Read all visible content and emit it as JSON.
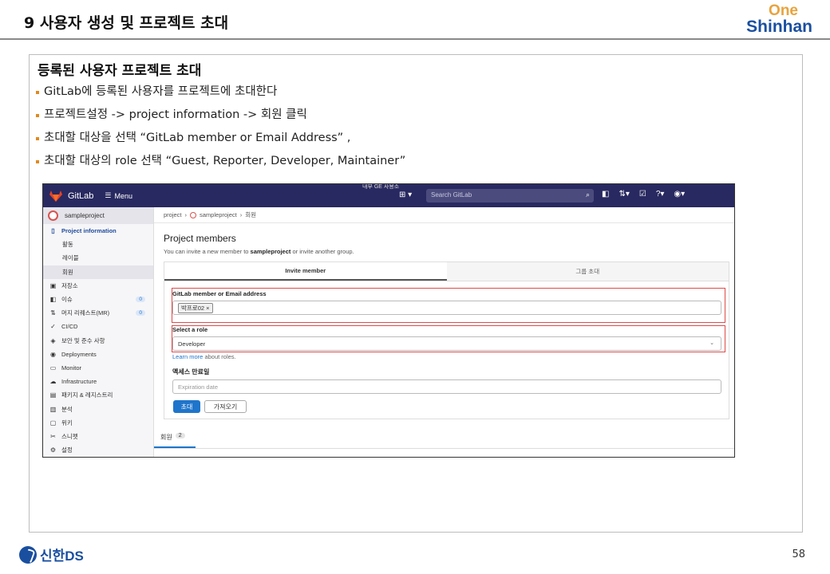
{
  "slide": {
    "title": "9 사용자 생성 및 프로젝트 초대",
    "brand_top": "One",
    "brand_bottom": "Shinhan",
    "page_number": "58",
    "footer_logo": "신한DS"
  },
  "section": {
    "title": "등록된 사용자 프로젝트 초대",
    "bullets": [
      "GitLab에 등록된 사용자를 프로젝트에 초대한다",
      "프로젝트설정 -> project information ->  회원 클릭",
      "초대할 대상을 선택 “GitLab member or Email Address” ,",
      "초대할 대상의 role 선택 “Guest, Reporter, Developer, Maintainer”"
    ]
  },
  "gitlab": {
    "top_note": "내부 GE 사용소",
    "app_name": "GitLab",
    "menu_label": "Menu",
    "search_placeholder": "Search GitLab",
    "project_name": "sampleproject",
    "sidebar": [
      {
        "icon": "▯",
        "label": "Project information",
        "kind": "top"
      },
      {
        "label": "활동",
        "kind": "sub"
      },
      {
        "label": "레이블",
        "kind": "sub"
      },
      {
        "label": "회원",
        "kind": "sub-active"
      },
      {
        "icon": "▣",
        "label": "저장소"
      },
      {
        "icon": "◧",
        "label": "이슈",
        "count": "0"
      },
      {
        "icon": "⇅",
        "label": "머지 리퀘스트(MR)",
        "count": "0"
      },
      {
        "icon": "✓",
        "label": "CI/CD"
      },
      {
        "icon": "◈",
        "label": "보안 및 준수 사항"
      },
      {
        "icon": "◉",
        "label": "Deployments"
      },
      {
        "icon": "▭",
        "label": "Monitor"
      },
      {
        "icon": "☁",
        "label": "Infrastructure"
      },
      {
        "icon": "▤",
        "label": "패키지 & 레지스트리"
      },
      {
        "icon": "▥",
        "label": "분석"
      },
      {
        "icon": "▢",
        "label": "위키"
      },
      {
        "icon": "✂",
        "label": "스니펫"
      },
      {
        "icon": "⚙",
        "label": "설정"
      }
    ],
    "breadcrumb": [
      "project",
      "sampleproject",
      "회원"
    ],
    "page_title": "Project members",
    "desc_prefix": "You can invite a new member to ",
    "desc_bold": "sampleproject",
    "desc_suffix": " or invite another group.",
    "tab_invite": "Invite member",
    "tab_group": "그룹 초대",
    "member_label": "GitLab member or Email address",
    "member_chip": "박프로02 ×",
    "role_label": "Select a role",
    "role_value": "Developer",
    "learn_link": "Learn more",
    "learn_suffix": " about roles.",
    "expiry_label": "액세스 만료일",
    "expiry_placeholder": "Expiration date",
    "invite_button": "초대",
    "import_button": "가져오기",
    "members_tab": "회원",
    "members_count": "2"
  }
}
